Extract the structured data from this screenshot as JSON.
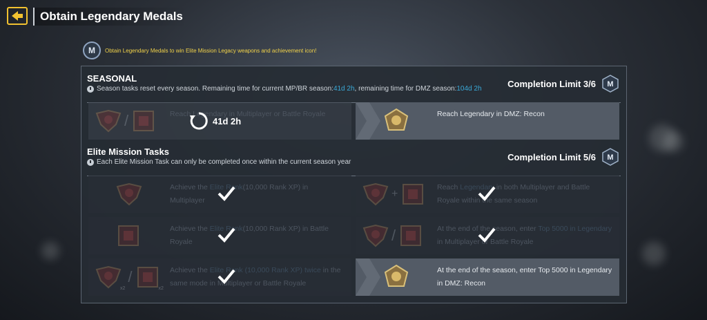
{
  "header": {
    "title": "Obtain Legendary Medals"
  },
  "info": {
    "text": "Obtain Legendary Medals to win Elite Mission Legacy weapons and achievement icon!",
    "badge": "M"
  },
  "seasonal": {
    "title": "SEASONAL",
    "note_prefix": "Season tasks reset every season. Remaining time for current MP/BR season: ",
    "mpbr_time": "41d 2h",
    "note_mid": ", remaining time for DMZ season: ",
    "dmz_time": "104d 2h",
    "limit": "Completion Limit 3/6",
    "tasks": [
      {
        "pre": "Reach ",
        "hl": "",
        "post": "",
        "text": "Reach Legendary in Multiplayer or Battle Royale",
        "timer": "41d 2h"
      },
      {
        "text": "Reach Legendary in DMZ: Recon"
      }
    ]
  },
  "elite": {
    "title": "Elite Mission Tasks",
    "note": "Each Elite Mission Task can only be completed once within the current season year",
    "limit": "Completion Limit 5/6",
    "tasks": [
      {
        "a": "Achieve the ",
        "b": "Elite Rank",
        "c": "(10,000 Rank XP) in Multiplayer"
      },
      {
        "a": "Reach ",
        "b": "Legendary",
        "c": " in both Multiplayer and Battle Royale within the same season"
      },
      {
        "a": "Achieve the ",
        "b": "Elite Rank",
        "c": "(10,000 Rank XP) in Battle Royale"
      },
      {
        "a": "At the end of the season, enter ",
        "b": "Top 5000 in Legendary",
        "c": " in Multiplayer or Battle Royale"
      },
      {
        "a": "Achieve the ",
        "b": "Elite Rank (10,000 Rank XP) twice",
        "c": " in the same mode in Multiplayer or Battle Royale"
      },
      {
        "text": "At the end of the season, enter Top 5000 in Legendary in DMZ: Recon"
      }
    ],
    "x2": "x2"
  },
  "colors": {
    "accent": "#f2c230",
    "highlight": "#3aa9d8",
    "info_text": "#f1d24a"
  },
  "icons": [
    "back-arrow-icon",
    "medal-m-icon",
    "clock-icon",
    "refresh-timer-icon",
    "checkmark-icon",
    "red-medal-icon",
    "red-crest-icon",
    "gold-medal-icon"
  ]
}
